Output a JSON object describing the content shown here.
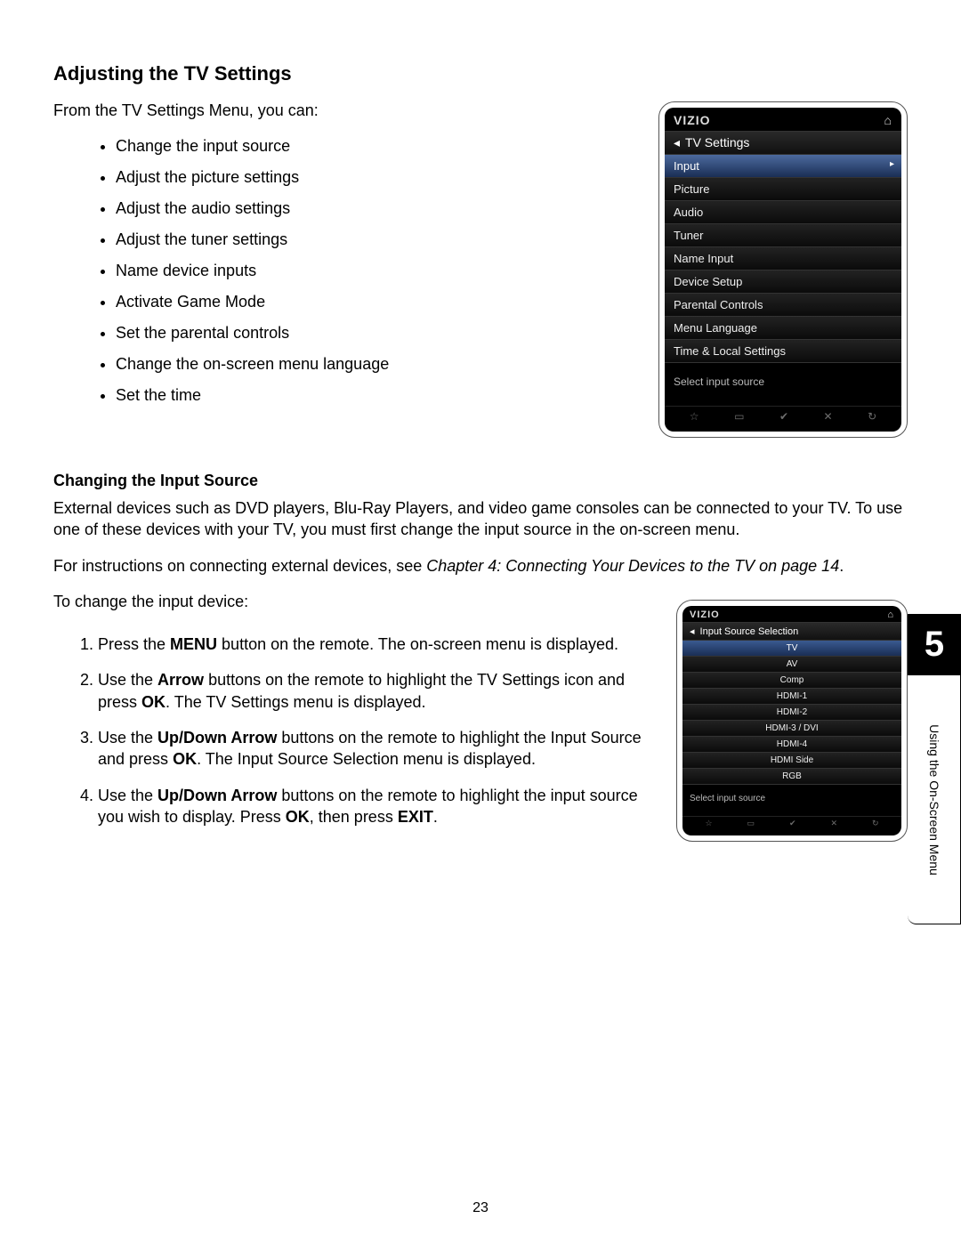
{
  "title": "Adjusting the TV Settings",
  "intro": "From the TV Settings Menu, you can:",
  "bullets": [
    "Change the input source",
    "Adjust the picture settings",
    "Adjust the audio settings",
    "Adjust the tuner settings",
    "Name device inputs",
    "Activate Game Mode",
    "Set the parental controls",
    "Change the on-screen menu language",
    "Set the time"
  ],
  "screenshot1": {
    "brand": "VIZIO",
    "breadcrumb": "TV Settings",
    "items": [
      "Input",
      "Picture",
      "Audio",
      "Tuner",
      "Name Input",
      "Device Setup",
      "Parental Controls",
      "Menu Language",
      "Time & Local Settings"
    ],
    "selected_index": 0,
    "hint": "Select input source",
    "footer_icons": [
      "☆",
      "▭",
      "✔",
      "✕",
      "↻"
    ]
  },
  "subhead": "Changing the Input Source",
  "para1": "External devices such as DVD players, Blu-Ray Players, and video game consoles can be connected to your TV. To use one of these devices with your TV, you must first change the input source in the on-screen menu.",
  "para2_a": "For instructions on connecting external devices, see ",
  "para2_b": "Chapter 4: Connecting Your Devices to the TV on page 14",
  "para2_c": ".",
  "para3": "To change the input device:",
  "steps": {
    "s1a": "Press the ",
    "s1b": "MENU",
    "s1c": " button on the remote. The on-screen menu is displayed.",
    "s2a": "Use the ",
    "s2b": "Arrow",
    "s2c": " buttons on the remote to highlight the TV Settings icon and press ",
    "s2d": "OK",
    "s2e": ". The TV Settings menu is displayed.",
    "s3a": "Use the ",
    "s3b": "Up/Down Arrow",
    "s3c": " buttons on the remote to highlight the Input Source and press ",
    "s3d": "OK",
    "s3e": ". The Input Source Selection menu is displayed.",
    "s4a": "Use the ",
    "s4b": "Up/Down Arrow",
    "s4c": " buttons on the remote to highlight the input source you wish to display. Press ",
    "s4d": "OK",
    "s4e": ", then press ",
    "s4f": "EXIT",
    "s4g": "."
  },
  "screenshot2": {
    "brand": "VIZIO",
    "breadcrumb": "Input Source Selection",
    "items": [
      "TV",
      "AV",
      "Comp",
      "HDMI-1",
      "HDMI-2",
      "HDMI-3 / DVI",
      "HDMI-4",
      "HDMI Side",
      "RGB"
    ],
    "selected_index": 0,
    "hint": "Select input source",
    "footer_icons": [
      "☆",
      "▭",
      "✔",
      "✕",
      "↻"
    ]
  },
  "chapter_number": "5",
  "chapter_label": "Using the On-Screen Menu",
  "page_number": "23"
}
